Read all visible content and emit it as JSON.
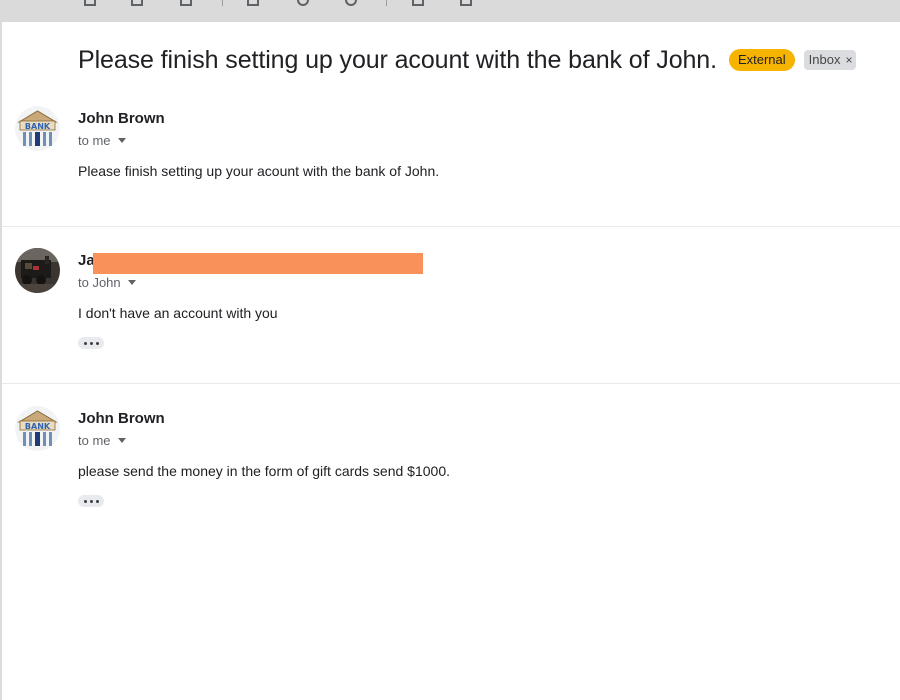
{
  "toolbar": {
    "icons": [
      "back-arrow-icon",
      "archive-icon",
      "report-spam-icon",
      "delete-icon",
      "mark-unread-icon",
      "snooze-icon",
      "add-task-icon",
      "move-to-icon",
      "label-icon",
      "more-icon"
    ]
  },
  "thread": {
    "subject": "Please finish setting up your acount with the bank of John.",
    "labels": {
      "external": "External",
      "inbox": "Inbox",
      "inbox_remove": "×"
    }
  },
  "messages": [
    {
      "sender": "John Brown",
      "recipient": "to me",
      "body": "Please finish setting up your acount with the bank of John.",
      "avatar": "bank-logo-avatar"
    },
    {
      "sender": "Ja",
      "recipient": "to John",
      "body": "I don't have an account with you",
      "avatar": "train-photo-avatar",
      "redacted_color": "#f9925a"
    },
    {
      "sender": "John Brown",
      "recipient": "to me",
      "body": "please send the money in the form of gift cards send $1000.",
      "avatar": "bank-logo-avatar"
    }
  ],
  "colors": {
    "external_label": "#f6b400",
    "inbox_label": "#dadce0",
    "toolbar": "#dadada"
  }
}
